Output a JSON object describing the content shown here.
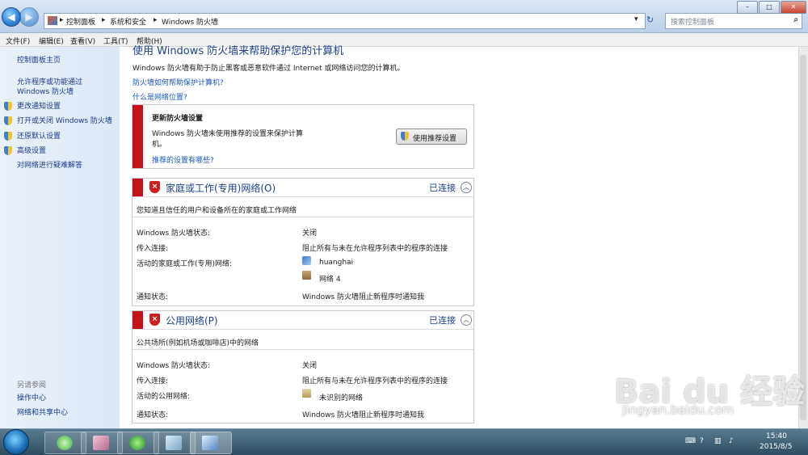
{
  "address": {
    "crumbs": [
      "控制面板",
      "系统和安全",
      "Windows 防火墙"
    ],
    "search_placeholder": "搜索控制面板"
  },
  "menubar": [
    "文件(F)",
    "编辑(E)",
    "查看(V)",
    "工具(T)",
    "帮助(H)"
  ],
  "sidebar": {
    "home": "控制面板主页",
    "items": [
      {
        "label": "允许程序或功能通过 Windows 防火墙",
        "shield": false
      },
      {
        "label": "更改通知设置",
        "shield": true
      },
      {
        "label": "打开或关闭 Windows 防火墙",
        "shield": true
      },
      {
        "label": "还原默认设置",
        "shield": true
      },
      {
        "label": "高级设置",
        "shield": true
      },
      {
        "label": "对网络进行疑难解答",
        "shield": false
      }
    ],
    "see_also_title": "另请参阅",
    "see_also": [
      "操作中心",
      "网络和共享中心"
    ]
  },
  "main": {
    "heading": "使用 Windows 防火墙来帮助保护您的计算机",
    "intro": "Windows 防火墙有助于防止黑客或恶意软件通过 Internet 或网络访问您的计算机。",
    "link1": "防火墙如何帮助保护计算机?",
    "link2": "什么是网络位置?",
    "update": {
      "title": "更新防火墙设置",
      "desc_line1": "Windows 防火墙未使用推荐的设置来保护计算",
      "desc_line2": "机。",
      "button": "使用推荐设置",
      "link": "推荐的设置有哪些?"
    },
    "home_network": {
      "name": "家庭或工作(专用)网络(O)",
      "status": "已连接",
      "description": "您知道且信任的用户和设备所在的家庭或工作网络",
      "rows": {
        "state_label": "Windows 防火墙状态:",
        "state_value": "关闭",
        "incoming_label": "传入连接:",
        "incoming_value": "阻止所有与未在允许程序列表中的程序的连接",
        "active_label": "活动的家庭或工作(专用)网络:",
        "active_values": [
          "huanghai",
          "网络  4"
        ],
        "notify_label": "通知状态:",
        "notify_value": "Windows 防火墙阻止新程序时通知我"
      }
    },
    "public_network": {
      "name": "公用网络(P)",
      "status": "已连接",
      "description": "公共场所(例如机场或咖啡店)中的网络",
      "rows": {
        "state_label": "Windows 防火墙状态:",
        "state_value": "关闭",
        "incoming_label": "传入连接:",
        "incoming_value": "阻止所有与未在允许程序列表中的程序的连接",
        "active_label": "活动的公用网络:",
        "active_value": "未识别的网络",
        "notify_label": "通知状态:",
        "notify_value": "Windows 防火墙阻止新程序时通知我"
      }
    }
  },
  "taskbar": {
    "time": "15:40",
    "date": "2015/8/5",
    "tray_icons": [
      "keyboard-icon",
      "help-icon",
      "network-icon",
      "volume-icon"
    ]
  },
  "watermark": {
    "logo_text": "Bai du 经验",
    "url": "jingyan.baidu.com"
  },
  "colors": {
    "alert_red": "#c4121a",
    "link_blue": "#1a56b8",
    "network_title_blue": "#1c3f8c"
  }
}
